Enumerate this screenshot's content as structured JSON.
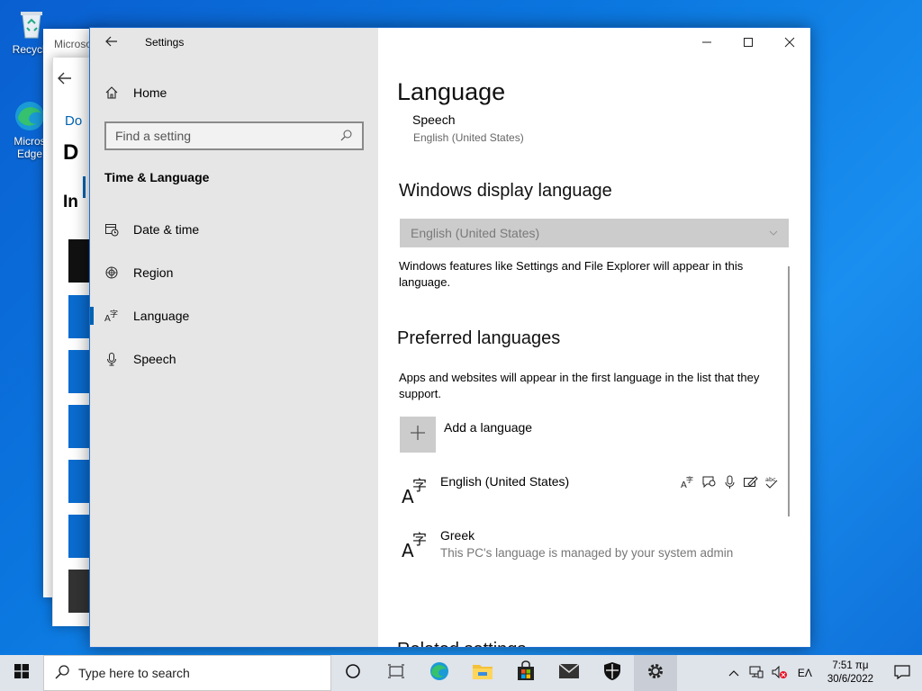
{
  "desktop": {
    "icons": [
      {
        "label": "Recycle"
      },
      {
        "label": "Micros Edge"
      }
    ]
  },
  "background_window": {
    "title_partial": "Microso",
    "heading_partial": "D",
    "link_partial": "Do",
    "subheading_partial": "In"
  },
  "settings": {
    "title": "Settings",
    "nav": {
      "home": "Home",
      "search_placeholder": "Find a setting",
      "section": "Time & Language",
      "items": [
        {
          "label": "Date & time",
          "icon": "calendar-clock-icon"
        },
        {
          "label": "Region",
          "icon": "globe-icon"
        },
        {
          "label": "Language",
          "icon": "language-icon",
          "active": true
        },
        {
          "label": "Speech",
          "icon": "microphone-icon"
        }
      ]
    },
    "content": {
      "page_title": "Language",
      "speech_label": "Speech",
      "speech_value": "English (United States)",
      "display_heading": "Windows display language",
      "display_value": "English (United States)",
      "display_desc": "Windows features like Settings and File Explorer will appear in this language.",
      "preferred_heading": "Preferred languages",
      "preferred_desc": "Apps and websites will appear in the first language in the list that they support.",
      "add_language": "Add a language",
      "languages": [
        {
          "name": "English (United States)",
          "note": ""
        },
        {
          "name": "Greek",
          "note": "This PC's language is managed by your system admin"
        }
      ],
      "related_partial": "Related settings"
    }
  },
  "taskbar": {
    "search_placeholder": "Type here to search",
    "input_indicator": "ΕΛ",
    "time": "7:51 πμ",
    "date": "30/6/2022"
  },
  "colors": {
    "accent": "#0063b1",
    "desktop": "#0b78e0"
  }
}
